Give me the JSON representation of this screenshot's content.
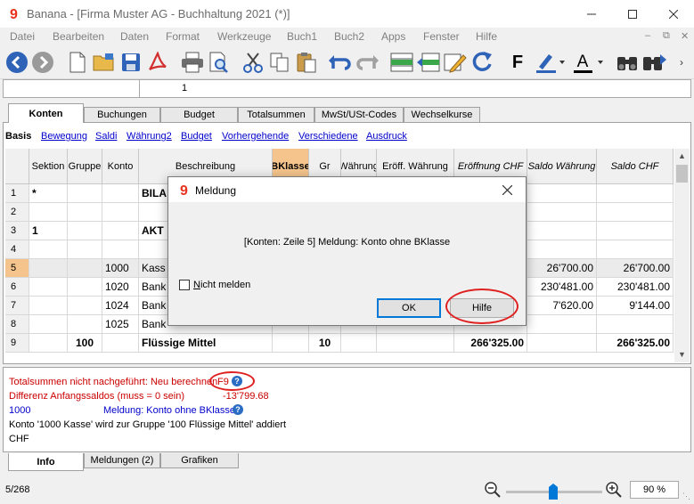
{
  "window": {
    "title": "Banana - [Firma Muster AG - Buchhaltung 2021 (*)]"
  },
  "menu": [
    "Datei",
    "Bearbeiten",
    "Daten",
    "Format",
    "Werkzeuge",
    "Buch1",
    "Buch2",
    "Apps",
    "Fenster",
    "Hilfe"
  ],
  "toolbar": {
    "bold_label": "F"
  },
  "cell_line": {
    "value": "1"
  },
  "tabs": [
    "Konten",
    "Buchungen",
    "Budget",
    "Totalsummen",
    "MwSt/USt-Codes",
    "Wechselkurse"
  ],
  "views": [
    "Basis",
    "Bewegung",
    "Saldi",
    "Währung2",
    "Budget",
    "Vorhergehende",
    "Verschiedene",
    "Ausdruck"
  ],
  "columns": [
    "Sektion",
    "Gruppe",
    "Konto",
    "Beschreibung",
    "BKlasse",
    "Gr",
    "Währung",
    "Eröff. Währung",
    "Eröffnung CHF",
    "Saldo Währung",
    "Saldo CHF"
  ],
  "rows": [
    {
      "num": "1",
      "sektion": "*",
      "gruppe": "",
      "konto": "",
      "beschr": "BILA",
      "bklasse": "",
      "gr": "",
      "waehrung": "",
      "eroeff_w": "",
      "eroeff_chf": "",
      "saldo_w": "",
      "saldo_chf": ""
    },
    {
      "num": "2",
      "sektion": "",
      "gruppe": "",
      "konto": "",
      "beschr": "",
      "bklasse": "",
      "gr": "",
      "waehrung": "",
      "eroeff_w": "",
      "eroeff_chf": "",
      "saldo_w": "",
      "saldo_chf": ""
    },
    {
      "num": "3",
      "sektion": "1",
      "gruppe": "",
      "konto": "",
      "beschr": "AKT",
      "bklasse": "",
      "gr": "",
      "waehrung": "",
      "eroeff_w": "",
      "eroeff_chf": "",
      "saldo_w": "",
      "saldo_chf": ""
    },
    {
      "num": "4",
      "sektion": "",
      "gruppe": "",
      "konto": "",
      "beschr": "",
      "bklasse": "",
      "gr": "",
      "waehrung": "",
      "eroeff_w": "",
      "eroeff_chf": "",
      "saldo_w": "",
      "saldo_chf": ""
    },
    {
      "num": "5",
      "sektion": "",
      "gruppe": "",
      "konto": "1000",
      "beschr": "Kass",
      "bklasse": "",
      "gr": "",
      "waehrung": "",
      "eroeff_w": "",
      "eroeff_chf": "",
      "saldo_w": "26'700.00",
      "saldo_chf": "26'700.00"
    },
    {
      "num": "6",
      "sektion": "",
      "gruppe": "",
      "konto": "1020",
      "beschr": "Bank",
      "bklasse": "",
      "gr": "",
      "waehrung": "",
      "eroeff_w": "",
      "eroeff_chf": "",
      "saldo_w": "230'481.00",
      "saldo_chf": "230'481.00"
    },
    {
      "num": "7",
      "sektion": "",
      "gruppe": "",
      "konto": "1024",
      "beschr": "Bank",
      "bklasse": "",
      "gr": "",
      "waehrung": "",
      "eroeff_w": "",
      "eroeff_chf": "",
      "saldo_w": "7'620.00",
      "saldo_chf": "9'144.00"
    },
    {
      "num": "8",
      "sektion": "",
      "gruppe": "",
      "konto": "1025",
      "beschr": "Bank",
      "bklasse": "",
      "gr": "",
      "waehrung": "",
      "eroeff_w": "",
      "eroeff_chf": "",
      "saldo_w": "",
      "saldo_chf": ""
    },
    {
      "num": "9",
      "sektion": "",
      "gruppe": "100",
      "konto": "",
      "beschr": "Flüssige Mittel",
      "bklasse": "",
      "gr": "10",
      "waehrung": "",
      "eroeff_w": "",
      "eroeff_chf": "266'325.00",
      "saldo_w": "",
      "saldo_chf": "266'325.00"
    }
  ],
  "info": {
    "line1_text": "Totalsummen nicht nachgeführt: Neu berechnen",
    "line1_key": "F9",
    "line2_text": "Differenz Anfangssaldos (muss = 0 sein)",
    "line2_value": "-13'799.68",
    "line3_account": "1000",
    "line3_text": "Meldung: Konto ohne BKlasse",
    "line4_text": "Konto '1000 Kasse' wird zur Gruppe '100 Flüssige Mittel' addiert",
    "line5_text": "CHF"
  },
  "bottom_tabs": [
    "Info",
    "Meldungen (2)",
    "Grafiken"
  ],
  "status": {
    "position": "5/268",
    "zoom": "90 %",
    "zoom_level_percent": 90
  },
  "dialog": {
    "title": "Meldung",
    "message": "[Konten: Zeile 5] Meldung: Konto ohne BKlasse",
    "checkbox_prefix": "N",
    "checkbox_rest": "icht melden",
    "ok_label": "OK",
    "help_label": "Hilfe"
  },
  "colors": {
    "accent": "#0078d7",
    "highlight": "#f5c48c",
    "link": "#0000cc",
    "error": "#cc0000",
    "annotation": "#e02020"
  }
}
